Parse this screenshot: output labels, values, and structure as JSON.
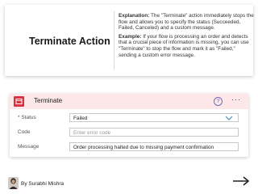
{
  "info": {
    "title": "Terminate Action",
    "explanation_label": "Explanation:",
    "explanation_text": " The \"Terminate\" action immediately stops the flow and allows you to specify the status (Succeeded, Failed, Canceled) and a custom message.",
    "example_label": "Example:",
    "example_text": " If your flow is processing an order and detects that a crucial piece of information is missing, you can use \"Terminate\" to stop the flow and mark it as \"Failed,\" sending a custom error message."
  },
  "terminate_card": {
    "title": "Terminate",
    "help_symbol": "?",
    "more_symbol": "···",
    "fields": {
      "status": {
        "required_mark": "*",
        "label": "Status",
        "value": "Failed"
      },
      "code": {
        "label": "Code",
        "placeholder": "Enter error code"
      },
      "message": {
        "label": "Message",
        "value": "Order processing halted due to missing payment confirmation"
      }
    }
  },
  "footer": {
    "byline": "By Surabhi Mishra"
  },
  "colors": {
    "header_bg": "#fde7e9",
    "icon_red": "#d8313f",
    "accent_blue": "#4a90c4"
  },
  "icons": [
    "terminate-icon",
    "help-icon",
    "more-options-icon",
    "chevron-down-icon",
    "avatar",
    "arrow-right-icon"
  ]
}
